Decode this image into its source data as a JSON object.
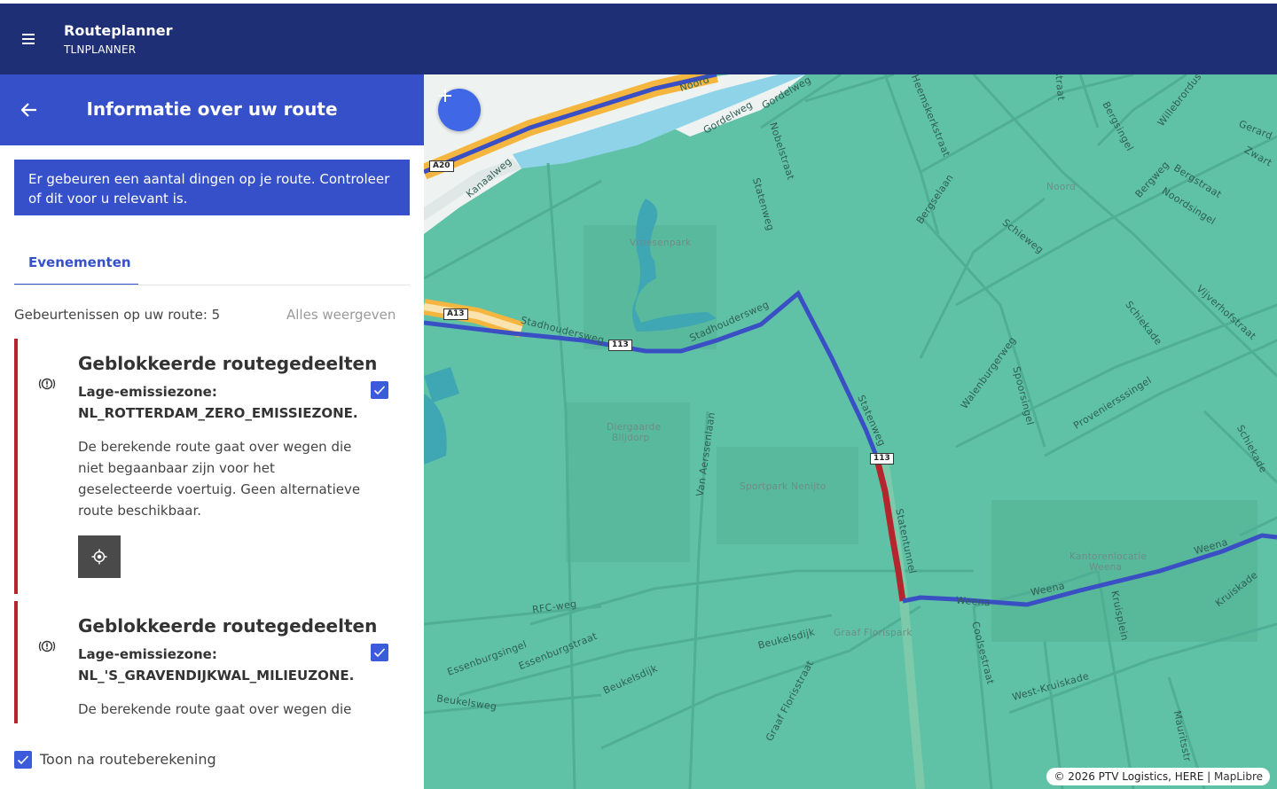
{
  "app": {
    "title": "Routeplanner",
    "subtitle": "TLNPLANNER",
    "menu_icon": "hamburger-icon"
  },
  "panel": {
    "title": "Informatie over uw route",
    "back_icon": "arrow-left-icon",
    "notice": "Er gebeuren een aantal dingen op je route. Controleer of dit voor u relevant is.",
    "tab_label": "Evenementen",
    "count_label": "Gebeurtenissen op uw route: 5",
    "show_all": "Alles weergeven",
    "events": [
      {
        "title": "Geblokkeerde routegedeelten",
        "zone_line1": "Lage-emissiezone:",
        "zone_line2": "NL_ROTTERDAM_ZERO_EMISSIEZONE.",
        "description": "De berekende route gaat over wegen die niet begaanbaar zijn voor het geselecteerde voertuig. Geen alternatieve route beschikbaar.",
        "checked": true
      },
      {
        "title": "Geblokkeerde routegedeelten",
        "zone_line1": "Lage-emissiezone:",
        "zone_line2": "NL_'S_GRAVENDIJKWAL_MILIEUZONE.",
        "description": "De berekende route gaat over wegen die",
        "checked": true
      }
    ],
    "footer_checkbox_label": "Toon na routeberekening",
    "footer_checked": true
  },
  "map": {
    "attribution": "© 2026 PTV Logistics, HERE | ",
    "attribution_link": "MapLibre",
    "colors": {
      "background": "#5fc2a6",
      "route": "#3a4fc4",
      "blocked": "#b3262e",
      "highway": "#f5b63f",
      "water": "#8fd3e8"
    },
    "street_labels": [
      "Noord",
      "Gordelweg",
      "Gordelweg",
      "Heemskerkstraat",
      "Bergsingel",
      "Willebrordus",
      "Gerard",
      "Zwart",
      "Nobelstraat",
      "Statenweg",
      "Bergselaan",
      "Noord",
      "Bergweg",
      "Bergstraat",
      "Noordsingel",
      "Kanaalweg",
      "Vroesenpark",
      "Schieweg",
      "Stadhoudersweg",
      "Stadhoudersweg",
      "Vijverhofstraat",
      "Schiekade",
      "Walenburgerweg",
      "Spoorsingel",
      "Proveniersssingel",
      "Statenweg",
      "Diergaarde",
      "Blijdorp",
      "Van Aerssenlaan",
      "Sportpark Nenijto",
      "Schiekade",
      "Statentunnel",
      "Kantorenlocatie",
      "Weena",
      "Weena",
      "Weena",
      "Weena",
      "Kruiskade",
      "Kruisplein",
      "RFC-weg",
      "Beukelsdijk",
      "Graaf Florispark",
      "Essenburgsingel",
      "Essenburgstraat",
      "Beukelsdijk",
      "Coolsestraat",
      "West-Kruiskade",
      "Beukelsweg",
      "Graaf Florisstraat",
      "Mauritsstr",
      "straat"
    ],
    "shields": [
      "A20",
      "A13",
      "113",
      "113"
    ]
  }
}
